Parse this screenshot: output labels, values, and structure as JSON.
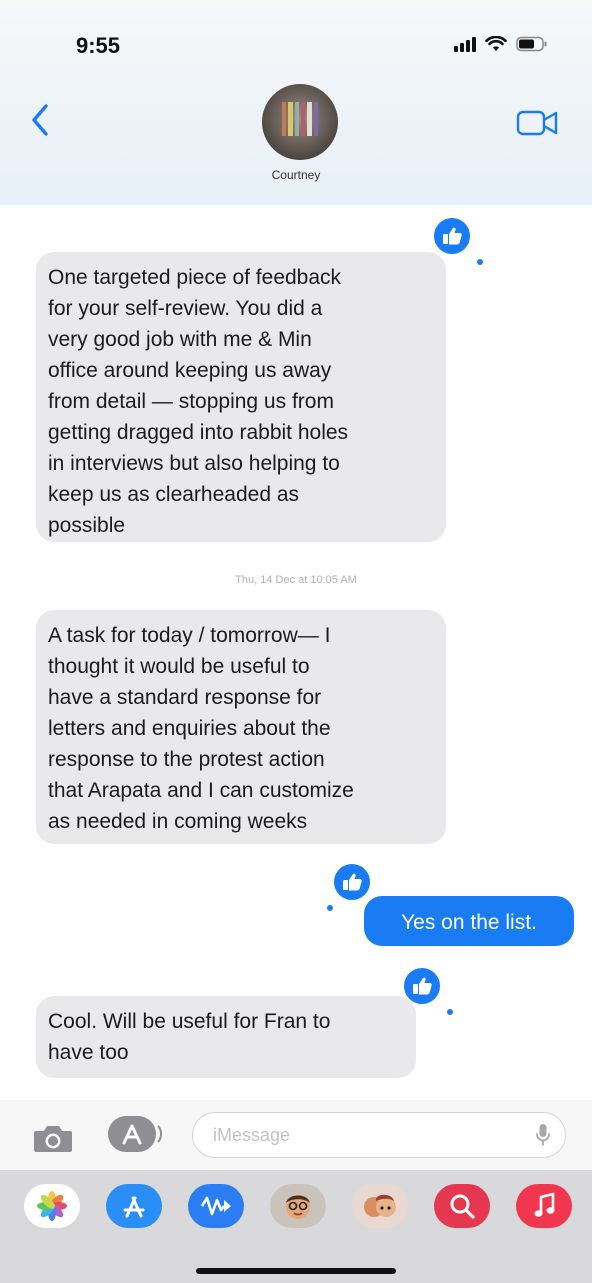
{
  "status_bar": {
    "time": "9:55"
  },
  "header": {
    "contact_name": "Courtney"
  },
  "messages": [
    {
      "direction": "incoming",
      "text": "One targeted piece of feedback\nfor your self-review. You did a\nvery good job with me & Min\noffice around keeping us away\nfrom detail — stopping us from\ngetting dragged into rabbit holes\nin interviews but also helping to\nkeep us as clearheaded as\npossible",
      "tapback": "thumbs-up-icon"
    },
    {
      "direction": "incoming",
      "text": "A task for today / tomorrow— I\nthought it would be useful to\nhave a standard response for\nletters and enquiries about the\nresponse to the protest action\nthat Arapata and I can customize\nas needed in coming weeks"
    },
    {
      "direction": "outgoing",
      "text": "Yes on the list.",
      "tapback": "thumbs-up-icon"
    },
    {
      "direction": "incoming",
      "text": "Cool. Will be useful for Fran to\nhave too",
      "tapback": "thumbs-up-icon"
    }
  ],
  "timestamp": "Thu, 14 Dec at 10:05 AM",
  "input": {
    "placeholder": "iMessage"
  },
  "app_drawer": [
    "photos-icon",
    "app-store-icon",
    "audio-message-icon",
    "memoji-icon",
    "memoji-stickers-icon",
    "search-images-icon",
    "music-icon"
  ],
  "colors": {
    "accent": "#1a7cf5",
    "incoming_bubble": "#e9e9eb",
    "drawer_bg": "#d9d9db"
  }
}
